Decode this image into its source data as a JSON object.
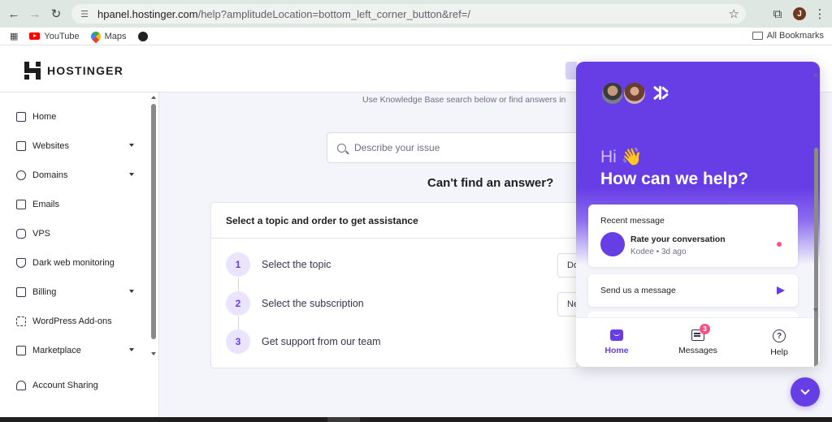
{
  "browser": {
    "url_host": "hpanel.hostinger.com",
    "url_path": "/help?amplitudeLocation=bottom_left_corner_button&ref=/",
    "profile_initial": "J",
    "bookmarks": [
      {
        "label": "YouTube",
        "icon": "youtube-icon"
      },
      {
        "label": "Maps",
        "icon": "maps-icon"
      }
    ],
    "all_bookmarks": "All Bookmarks"
  },
  "header": {
    "brand": "HOSTINGER"
  },
  "sidebar": {
    "items": [
      {
        "label": "Home",
        "icon": "home-icon",
        "expandable": false
      },
      {
        "label": "Websites",
        "icon": "websites-icon",
        "expandable": true
      },
      {
        "label": "Domains",
        "icon": "globe-icon",
        "expandable": true
      },
      {
        "label": "Emails",
        "icon": "mail-icon",
        "expandable": false
      },
      {
        "label": "VPS",
        "icon": "server-icon",
        "expandable": false
      },
      {
        "label": "Dark web monitoring",
        "icon": "shield-icon",
        "expandable": false
      },
      {
        "label": "Billing",
        "icon": "billing-icon",
        "expandable": true
      },
      {
        "label": "WordPress Add-ons",
        "icon": "addons-icon",
        "expandable": false
      },
      {
        "label": "Marketplace",
        "icon": "marketplace-icon",
        "expandable": true
      },
      {
        "label": "Account Sharing",
        "icon": "users-icon",
        "expandable": false
      }
    ]
  },
  "main": {
    "hint": "Use Knowledge Base search below or find answers in",
    "search_placeholder": "Describe your issue",
    "cant_find": "Can't find an answer?",
    "card_title": "Select a topic and order to get assistance",
    "steps": [
      {
        "num": "1",
        "label": "Select the topic",
        "select_value": "Do"
      },
      {
        "num": "2",
        "label": "Select the subscription",
        "select_value": "Ne"
      },
      {
        "num": "3",
        "label": "Get support from our team",
        "select_value": ""
      }
    ]
  },
  "chat": {
    "greeting": "Hi 👋",
    "headline": "How can we help?",
    "recent_title": "Recent message",
    "recent_name": "Rate your conversation",
    "recent_meta": "Kodee • 3d ago",
    "send_label": "Send us a message",
    "tabs": [
      {
        "label": "Home",
        "active": true
      },
      {
        "label": "Messages",
        "badge": "3"
      },
      {
        "label": "Help"
      }
    ]
  },
  "colors": {
    "accent": "#673de6",
    "accent_light": "#ebe4ff",
    "notification": "#fc5185"
  }
}
